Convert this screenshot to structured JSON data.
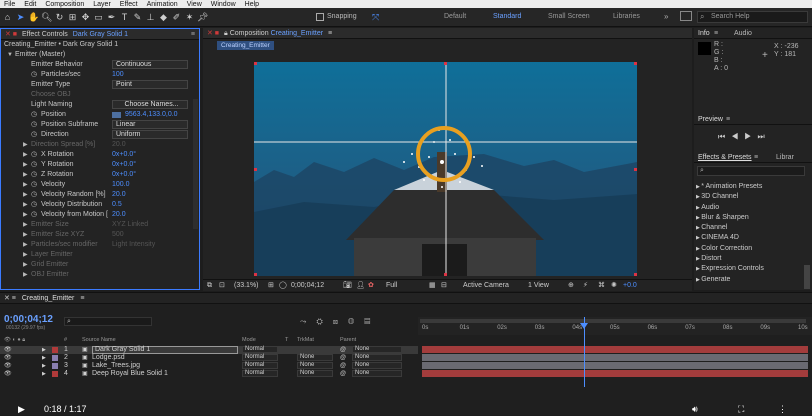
{
  "menu": [
    "File",
    "Edit",
    "Composition",
    "Layer",
    "Effect",
    "Animation",
    "View",
    "Window",
    "Help"
  ],
  "toolbar": {
    "snapping": "Snapping",
    "workspaces": [
      "Default",
      "Standard",
      "Small Screen",
      "Libraries"
    ],
    "search_placeholder": "Search Help"
  },
  "effect_controls": {
    "tab_label": "Effect Controls",
    "tab_layer": "Dark Gray Solid 1",
    "header": "Creating_Emitter • Dark Gray Solid 1",
    "rows": [
      {
        "label": "Emitter (Master)",
        "value": ""
      },
      {
        "label": "Emitter Behavior",
        "value": "Continuous"
      },
      {
        "label": "Particles/sec",
        "value": "100"
      },
      {
        "label": "Emitter Type",
        "value": "Point"
      },
      {
        "label": "Choose OBJ",
        "value": ""
      },
      {
        "label": "Light Naming",
        "value": "Choose Names..."
      },
      {
        "label": "Position",
        "value": "9563.4,133.0,0.0"
      },
      {
        "label": "Position Subframe",
        "value": "Linear"
      },
      {
        "label": "Direction",
        "value": "Uniform"
      },
      {
        "label": "Direction Spread [%]",
        "value": "20.0"
      },
      {
        "label": "X Rotation",
        "value": "0x+0.0°"
      },
      {
        "label": "Y Rotation",
        "value": "0x+0.0°"
      },
      {
        "label": "Z Rotation",
        "value": "0x+0.0°"
      },
      {
        "label": "Velocity",
        "value": "100.0"
      },
      {
        "label": "Velocity Random [%]",
        "value": "20.0"
      },
      {
        "label": "Velocity Distribution",
        "value": "0.5"
      },
      {
        "label": "Velocity from Motion [",
        "value": "20.0"
      },
      {
        "label": "Emitter Size",
        "value": "XYZ Linked"
      },
      {
        "label": "Emitter Size XYZ",
        "value": "500"
      },
      {
        "label": "Particles/sec modifier",
        "value": "Light Intensity"
      },
      {
        "label": "Layer Emitter",
        "value": ""
      },
      {
        "label": "Grid Emitter",
        "value": ""
      },
      {
        "label": "OBJ Emitter",
        "value": ""
      }
    ]
  },
  "composition": {
    "tab_label": "Composition",
    "tab_name": "Creating_Emitter",
    "sub_tab": "Creating_Emitter",
    "zoom": "(33.1%)",
    "timecode": "0;00;04;12",
    "resolution": "Full",
    "camera": "Active Camera",
    "views": "1 View",
    "exposure": "+0.0"
  },
  "info": {
    "tabs": [
      "Info",
      "Audio"
    ],
    "rgb_labels": [
      "R :",
      "G :",
      "B :",
      "A : 0"
    ],
    "x": "X : -236",
    "y": "Y : 181"
  },
  "preview": {
    "title": "Preview"
  },
  "effects_presets": {
    "tabs": [
      "Effects & Presets",
      "Librar"
    ],
    "search_placeholder": "",
    "items": [
      "* Animation Presets",
      "3D Channel",
      "Audio",
      "Blur & Sharpen",
      "Channel",
      "CINEMA 4D",
      "Color Correction",
      "Distort",
      "Expression Controls",
      "Generate"
    ]
  },
  "timeline": {
    "tab": "Creating_Emitter",
    "timecode": "0;00;04;12",
    "fps": "00132 (29.97 fps)",
    "columns": [
      "#",
      "Source Name",
      "Mode",
      "T",
      "TrkMat",
      "Parent"
    ],
    "ruler": [
      "0s",
      "01s",
      "02s",
      "03s",
      "04s",
      "05s",
      "06s",
      "07s",
      "08s",
      "09s",
      "10s"
    ],
    "playhead_position": 0.42,
    "layers": [
      {
        "num": "1",
        "name": "Dark Gray Solid 1",
        "mode": "Normal",
        "trkmat": "",
        "parent": "None",
        "color": "#b03a3a",
        "selected": true
      },
      {
        "num": "2",
        "name": "Lodge.psd",
        "mode": "Normal",
        "trkmat": "None",
        "parent": "None",
        "color": "#8a7fb0",
        "selected": false
      },
      {
        "num": "3",
        "name": "Lake_Trees.jpg",
        "mode": "Normal",
        "trkmat": "None",
        "parent": "None",
        "color": "#8a7fb0",
        "selected": false
      },
      {
        "num": "4",
        "name": "Deep Royal Blue Solid 1",
        "mode": "Normal",
        "trkmat": "None",
        "parent": "None",
        "color": "#b03a3a",
        "selected": false
      }
    ]
  },
  "video_player": {
    "time": "0:18 / 1:17"
  },
  "colors": {
    "accent": "#4d8eff",
    "selection": "#e8a020",
    "layer_bar_red": "#a33c3c",
    "layer_bar_gray": "#6a6a72"
  }
}
